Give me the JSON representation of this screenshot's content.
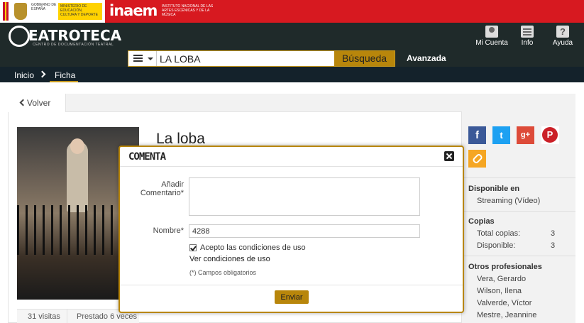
{
  "gov": {
    "gobierno": "GOBIERNO DE ESPAÑA",
    "ministerio": "MINISTERIO DE EDUCACIÓN, CULTURA Y DEPORTE",
    "inaem": "inaem",
    "inaem_text": "INSTITUTO NACIONAL DE LAS ARTES ESCÉNICAS Y DE LA MÚSICA"
  },
  "brand": {
    "name": "EATROTECA",
    "subtitle": "CENTRO DE DOCUMENTACIÓN TEATRAL"
  },
  "header_buttons": {
    "account": "Mi Cuenta",
    "info": "Info",
    "help": "Ayuda",
    "help_glyph": "?"
  },
  "search": {
    "value": "LA LOBA",
    "button": "Búsqueda",
    "advanced": "Avanzada"
  },
  "breadcrumb": {
    "home": "Inicio",
    "current": "Ficha"
  },
  "detail": {
    "back": "Volver",
    "title": "La loba",
    "visits": "31 visitas",
    "loans": "Prestado 6 veces"
  },
  "sidebar": {
    "social": {
      "facebook": "f",
      "twitter": "t",
      "google": "g+",
      "pinterest": "P"
    },
    "available_in": "Disponible en",
    "streaming": "Streaming (Vídeo)",
    "copies_title": "Copias",
    "total_label": "Total copias:",
    "total_value": "3",
    "available_label": "Disponible:",
    "available_value": "3",
    "pros_title": "Otros profesionales",
    "pros": [
      "Vera, Gerardo",
      "Wilson, Ilena",
      "Valverde, Víctor",
      "Mestre, Jeannine"
    ]
  },
  "modal": {
    "title": "COMENTA",
    "comment_label_1": "Añadir",
    "comment_label_2": "Comentario*",
    "comment_value": "",
    "name_label": "Nombre*",
    "name_value": "4288",
    "accept": "Acepto las condiciones de uso",
    "view_conditions": "Ver condiciones de uso",
    "required_note": "(*) Campos obligatorios",
    "send": "Enviar"
  },
  "colors": {
    "gov_red": "#d71920",
    "header_dark": "#1f2a2a",
    "accent_gold": "#b8860b"
  }
}
